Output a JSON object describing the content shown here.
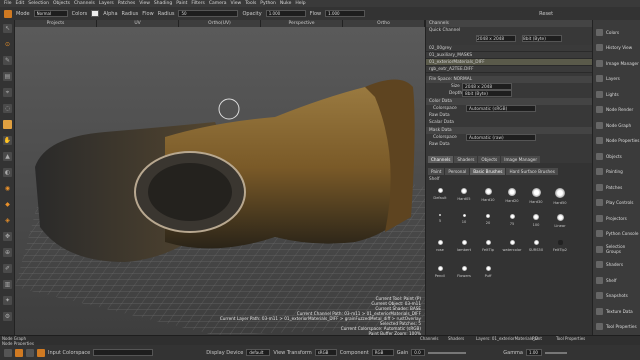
{
  "menu": [
    "File",
    "Edit",
    "Selection",
    "Objects",
    "Channels",
    "Layers",
    "Patches",
    "View",
    "Shading",
    "Paint",
    "Filters",
    "Camera",
    "View",
    "Tools",
    "Python",
    "Nuke",
    "Help"
  ],
  "toolopts": {
    "mode_label": "Mode",
    "mode_value": "Normal",
    "colors_label": "Colors",
    "alpha_label": "Alpha",
    "radius_label": "Radius",
    "flow_label": "Flow",
    "radius2_label": "Radius",
    "radius_value": "50",
    "opacity_label": "Opacity",
    "opacity_value": "1.000",
    "flow2_label": "Flow",
    "flow_value": "1.000",
    "reset_label": "Reset"
  },
  "view_tabs": [
    "Projects",
    "UV",
    "Ortho(UV)",
    "Perspective",
    "Ortho"
  ],
  "hud": [
    "Current Tool: Paint (P)",
    "Current Object: 03-m11",
    "Current Shader: BASE",
    "Current Channel Path: 03-m11 > 01_exteriorMaterials_DIFF",
    "Current Layer Path: 03-m11 > 01_exteriorMaterials_DIFF > grainFuzzedMetal_diff > rustOverlay",
    "Selected Patches: 5",
    "Current Colorspace: Automatic (sRGB)",
    "Paint Buffer Zoom: 100%"
  ],
  "channels": {
    "title": "Channels",
    "quick": "Quick Channel",
    "size": "2048 x 2048",
    "depth": "8bit (Byte)",
    "layers": [
      "02_00grey",
      "01_auxiliary_MASKS",
      "01_exteriorMaterials_DIFF",
      "rgb_extr_A2TEE.DIFF"
    ]
  },
  "props": {
    "file_space": "File Space: NORMAL",
    "size_label": "Size",
    "size_value": "2048 x 2048",
    "depth_label": "Depth",
    "depth_value": "8bit (Byte)",
    "color_data": "Color Data",
    "colorspace_label": "Colorspace",
    "colorspace_value": "Automatic (sRGB)",
    "raw_data": "Raw Data",
    "scalar_data": "Scalar Data",
    "mask_data": "Mask Data",
    "colorspace2_value": "Automatic (raw)",
    "raw_data2": "Raw Data"
  },
  "mid_tabs": [
    "Channels",
    "Shaders",
    "Objects",
    "Image Manager"
  ],
  "brush_tabs": [
    "Paint",
    "Personal",
    "Basic Brushes",
    "Hard Surface Brushes"
  ],
  "shelf_label": "Shelf",
  "brushes": [
    "Default",
    "Hard05",
    "Hard10",
    "Hard20",
    "Hard30",
    "Hard50",
    "5",
    "10",
    "20",
    "75",
    "100",
    "Linear",
    "rose",
    "lambert",
    "FeltTip",
    "watercolor",
    "SURS50",
    "FeltTip2",
    "Pencil",
    "Flowers",
    "Puff"
  ],
  "sidebar": [
    "Colors",
    "History View",
    "Image Manager",
    "Layers",
    "Lights",
    "Node Render",
    "Node Graph",
    "Node Properties",
    "Objects",
    "Painting",
    "Patches",
    "Play Controls",
    "Projectors",
    "Python Console",
    "Selection Groups",
    "Shaders",
    "Shelf",
    "Snapshots",
    "Texture Data",
    "Tool Properties"
  ],
  "bottom_tabs": [
    "Node Graph",
    "Node Properties",
    "Channels",
    "Shaders",
    "Layers: 01_exteriorMaterials_D",
    "Paint",
    "Tool Properties"
  ],
  "status": {
    "input_label": "Input Colorspace",
    "display_label": "Display Device",
    "display_value": "default",
    "vt_label": "View Transform",
    "vt_value": "sRGB",
    "comp_label": "Component",
    "comp_value": "RGB",
    "gain_label": "Gain",
    "gain_value": "0.0",
    "gamma_label": "Gamma",
    "gamma_value": "1.00"
  }
}
